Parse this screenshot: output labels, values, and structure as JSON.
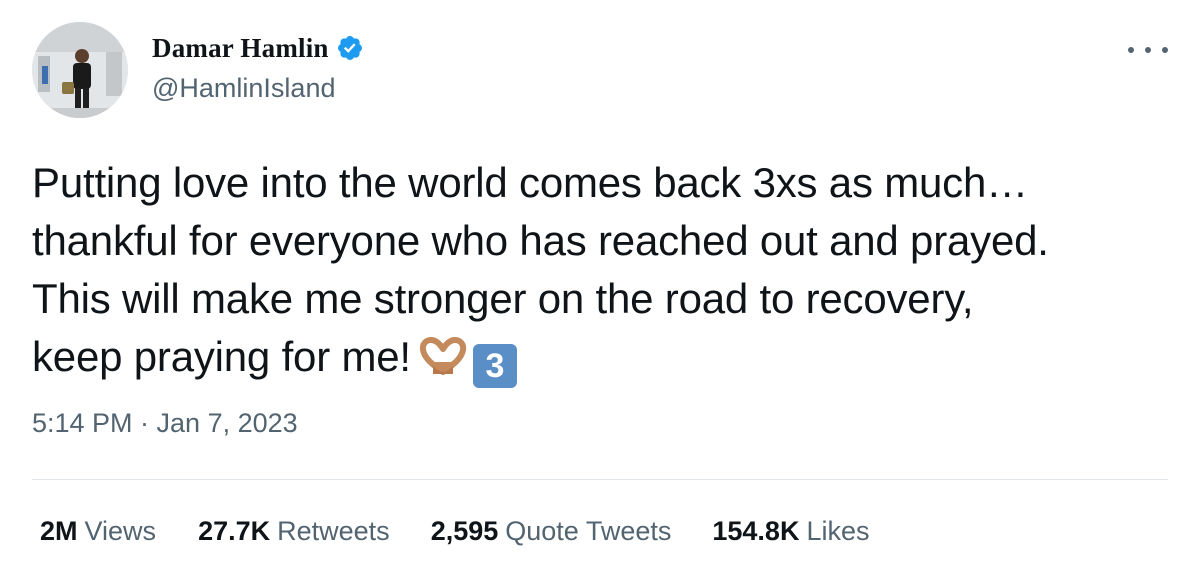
{
  "author": {
    "display_name": "Damar Hamlin",
    "handle": "@HamlinIsland",
    "verified": true
  },
  "tweet": {
    "text_lines": [
      "Putting love into the world comes back 3xs as much…",
      "thankful for everyone who has reached out and prayed.",
      "This will make me stronger on the road to recovery,",
      "keep praying for me!"
    ],
    "emoji_heart_hands": "heart-hands-emoji",
    "keycap_value": "3",
    "timestamp": "5:14 PM · Jan 7, 2023"
  },
  "stats": {
    "views": {
      "value": "2M",
      "label": "Views"
    },
    "retweets": {
      "value": "27.7K",
      "label": "Retweets"
    },
    "quotes": {
      "value": "2,595",
      "label": "Quote Tweets"
    },
    "likes": {
      "value": "154.8K",
      "label": "Likes"
    }
  },
  "colors": {
    "verified_badge": "#1d9bf0",
    "secondary_text": "#536471",
    "keycap": "#5a8ec6",
    "heart_hands": "#c48a5c"
  }
}
